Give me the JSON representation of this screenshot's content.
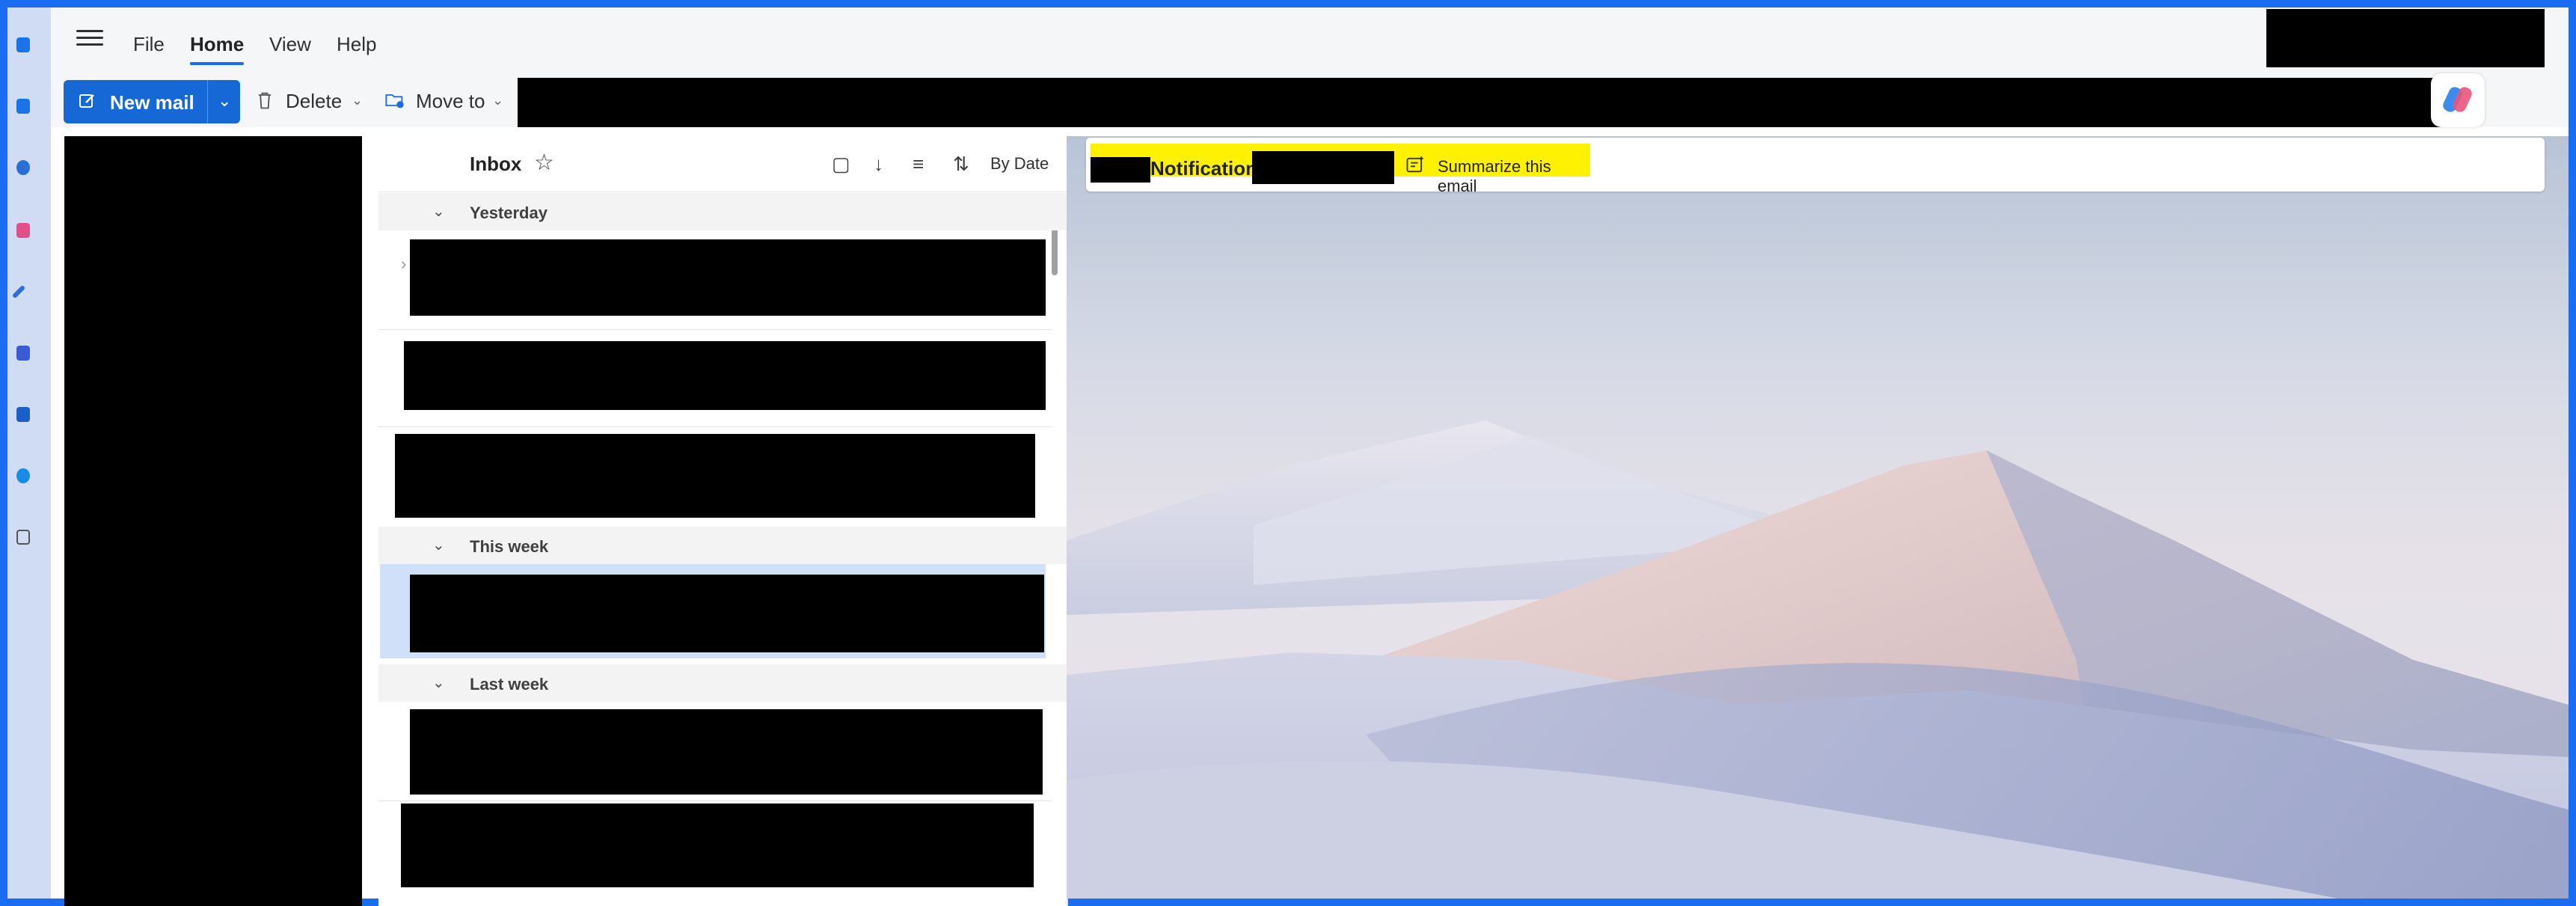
{
  "menu": {
    "file": "File",
    "home": "Home",
    "view": "View",
    "help": "Help"
  },
  "toolbar": {
    "new_mail": "New mail",
    "delete": "Delete",
    "move_to": "Move to"
  },
  "list": {
    "title": "Inbox",
    "sort_label": "By Date",
    "groups": [
      "Yesterday",
      "This week",
      "Last week"
    ]
  },
  "reading": {
    "notification_label": "Notification",
    "summarize_label": "Summarize this email"
  },
  "colors": {
    "accent": "#1568d6",
    "frame": "#1a6df0",
    "highlight": "#fff200",
    "selected_row": "#cfe0f8"
  }
}
